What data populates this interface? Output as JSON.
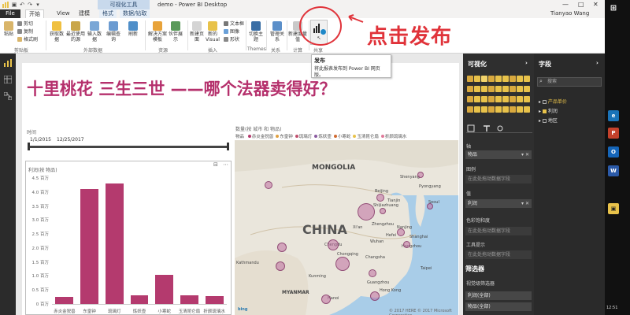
{
  "window": {
    "context_tab_title": "可视化工具",
    "app_title": "demo - Power BI Desktop",
    "user": "Tianyao Wang",
    "controls": [
      "—",
      "□",
      "✕"
    ]
  },
  "tabs": {
    "file": "File",
    "items": [
      "开始",
      "View",
      "建模",
      "格式",
      "数据/钻取"
    ],
    "active": "开始"
  },
  "ribbon": {
    "clipboard": {
      "paste": "粘贴",
      "cut": "剪切",
      "copy": "复制",
      "format_painter": "格式刷",
      "label": "剪贴板"
    },
    "external_data": {
      "get_data": "获取数据",
      "recent_sources": "最近使用的源",
      "enter_data": "输入数据",
      "edit_queries": "编辑查询",
      "refresh": "刷新",
      "label": "外部数据"
    },
    "resources": {
      "solution_templates": "解决方案模板",
      "partner_showcase": "伙伴展示",
      "label": "资源"
    },
    "insert": {
      "new_page": "新建页面",
      "new_visual": "新的Visual",
      "textbox": "文本框",
      "image": "图像",
      "shapes": "形状",
      "label": "插入"
    },
    "themes": {
      "switch_theme": "切换主题",
      "label": "Themes"
    },
    "relationships": {
      "manage": "管理关系",
      "label": "关系"
    },
    "calculations": {
      "new_measure": "新建度量值",
      "label": "计算"
    },
    "share": {
      "publish": "发布",
      "label": "共享"
    }
  },
  "tooltip": {
    "title": "发布",
    "description": "将此报表发布到 Power BI 网页版。"
  },
  "annotation": {
    "text": "点击发布"
  },
  "report": {
    "title": "十里桃花  三生三世 ——哪个法器卖得好？",
    "slicer": {
      "label": "时间",
      "start": "1/1/2015",
      "end": "12/25/2017"
    }
  },
  "bar_visual": {
    "title": "利润(按 物品)",
    "icons": "⊟ ⋯"
  },
  "chart_data": {
    "type": "bar",
    "title": "利润(按 物品)",
    "categories": [
      "赤炎金猊兽",
      "东皇钟",
      "琉璃灯",
      "炼妖壶",
      "小寒蛇",
      "玉清昆仑扇",
      "折颜琉璃水"
    ],
    "values": [
      0.25,
      4.1,
      4.3,
      0.3,
      1.05,
      0.3,
      0.27
    ],
    "yticks": [
      "0 百万",
      "0.5 百万",
      "1.0 百万",
      "1.5 百万",
      "2.0 百万",
      "2.5 百万",
      "3.0 百万",
      "3.5 百万",
      "4.0 百万",
      "4.5 百万"
    ],
    "ylim": [
      0,
      4.5
    ],
    "color": "#b43a6e"
  },
  "map_visual": {
    "title": "数量(按 城市 和 物品)",
    "legend_title": "物品",
    "legend": [
      {
        "name": "赤炎金猊兽",
        "color": "#b43a6e"
      },
      {
        "name": "东皇钟",
        "color": "#e0a040"
      },
      {
        "name": "琉璃灯",
        "color": "#c0506e"
      },
      {
        "name": "炼妖壶",
        "color": "#8a5aa0"
      },
      {
        "name": "小寒蛇",
        "color": "#d06a30"
      },
      {
        "name": "玉清昆仑扇",
        "color": "#e8c24a"
      },
      {
        "name": "折颜琉璃水",
        "color": "#e07a9a"
      }
    ],
    "labels": {
      "mongolia": "MONGOLIA",
      "china": "CHINA",
      "kathmandu": "Kathmandu",
      "myanmar": "MYANMAR"
    },
    "cities": [
      "Beijing",
      "Shenyang",
      "Tianjin",
      "Shijiazhuang",
      "Zhengzhou",
      "Xi'an",
      "Chengdu",
      "Chongqing",
      "Wuhan",
      "Nanjing",
      "Shanghai",
      "Hefei",
      "Hangzhou",
      "Changsha",
      "Guangzhou",
      "Hong Kong",
      "Taipei",
      "Hanoi",
      "Pyongyang",
      "Seoul",
      "Kunming"
    ],
    "bing": "bing",
    "copyright": "© 2017 HERE  © 2017 Microsoft Corporation"
  },
  "viz_pane": {
    "title": "可视化",
    "axis_label": "轴",
    "axis_value": "物品",
    "legend_label": "图例",
    "legend_drop": "在此处拖动数据字段",
    "value_label": "值",
    "value_value": "利润",
    "saturation_label": "色彩饱和度",
    "saturation_drop": "在此处拖动数据字段",
    "tooltips_label": "工具提示",
    "tooltips_drop": "在此处拖动数据字段",
    "filters_title": "筛选器",
    "visual_level_filters": "视觉级筛选器",
    "filter1": "利润(全部)",
    "filter2": "物品(全部)"
  },
  "fields_pane": {
    "title": "字段",
    "search_placeholder": "搜索",
    "items": [
      {
        "name": "产品单价",
        "checked": false,
        "color": "#e8c24a"
      },
      {
        "name": "利润",
        "checked": true
      },
      {
        "name": "地区",
        "checked": false
      }
    ]
  },
  "taskbar": {
    "time": "12:51",
    "icons": [
      "⊞",
      "e",
      "P",
      "O",
      "W",
      "▣"
    ]
  }
}
